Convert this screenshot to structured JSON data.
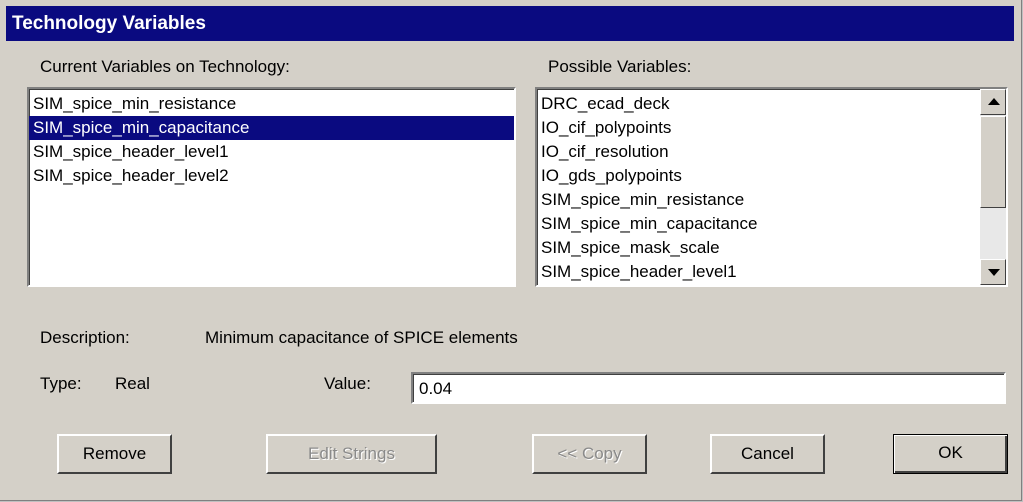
{
  "dialog": {
    "title": "Technology Variables"
  },
  "current": {
    "label": "Current Variables on Technology:",
    "items": [
      "SIM_spice_min_resistance",
      "SIM_spice_min_capacitance",
      "SIM_spice_header_level1",
      "SIM_spice_header_level2"
    ],
    "selected_index": 1
  },
  "possible": {
    "label": "Possible Variables:",
    "items": [
      "DRC_ecad_deck",
      "IO_cif_polypoints",
      "IO_cif_resolution",
      "IO_gds_polypoints",
      "SIM_spice_min_resistance",
      "SIM_spice_min_capacitance",
      "SIM_spice_mask_scale",
      "SIM_spice_header_level1"
    ]
  },
  "description": {
    "label": "Description:",
    "text": "Minimum capacitance of SPICE elements"
  },
  "type": {
    "label": "Type:",
    "value": "Real"
  },
  "value": {
    "label": "Value:",
    "field_value": "0.04"
  },
  "buttons": {
    "remove": "Remove",
    "edit_strings": "Edit Strings",
    "copy": "<< Copy",
    "cancel": "Cancel",
    "ok": "OK"
  }
}
